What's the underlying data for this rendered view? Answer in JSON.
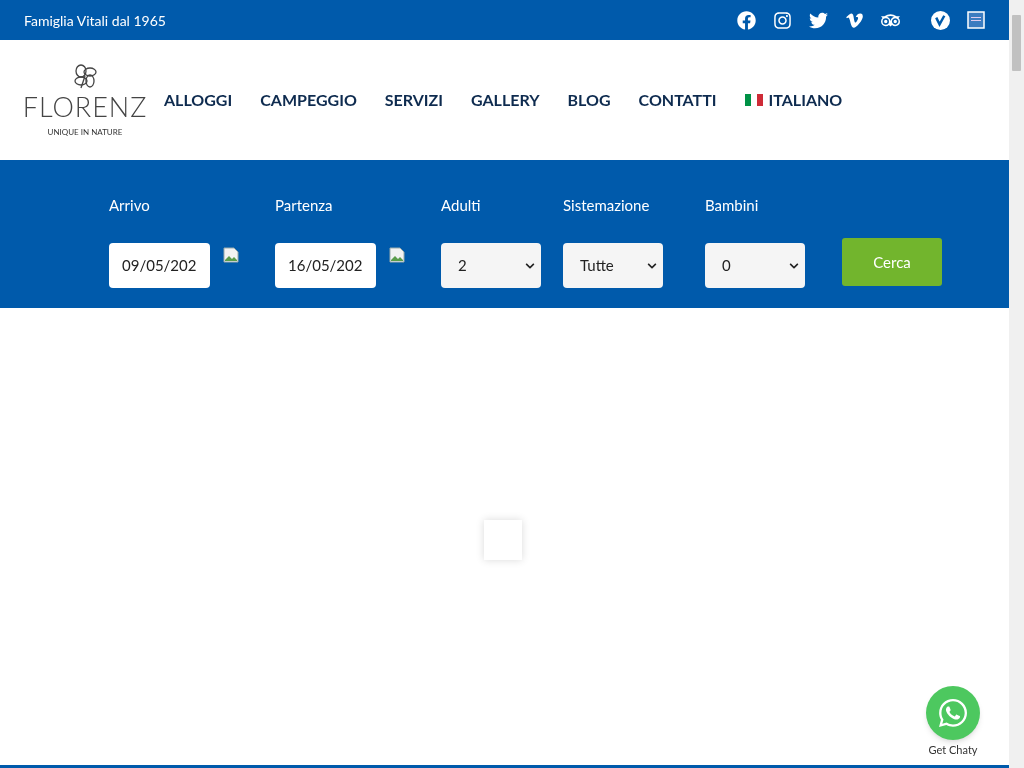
{
  "top_bar": {
    "tagline": "Famiglia Vitali dal 1965"
  },
  "logo": {
    "name": "FLORENZ",
    "tagline": "UNIQUE IN NATURE"
  },
  "nav": [
    {
      "label": "ALLOGGI"
    },
    {
      "label": "CAMPEGGIO"
    },
    {
      "label": "SERVIZI"
    },
    {
      "label": "GALLERY"
    },
    {
      "label": "BLOG"
    },
    {
      "label": "CONTATTI"
    },
    {
      "label": "ITALIANO",
      "kind": "language"
    }
  ],
  "booking": {
    "fields": [
      {
        "label": "Arrivo",
        "kind": "date",
        "value": "09/05/202"
      },
      {
        "label": "Partenza",
        "kind": "date",
        "value": "16/05/202"
      },
      {
        "label": "Adulti",
        "kind": "select",
        "value": "2"
      },
      {
        "label": "Sistemazione",
        "kind": "select",
        "value": "Tutte"
      },
      {
        "label": "Bambini",
        "kind": "select",
        "value": "0"
      }
    ],
    "button": "Cerca"
  },
  "chat": {
    "label": "Get Chaty"
  }
}
